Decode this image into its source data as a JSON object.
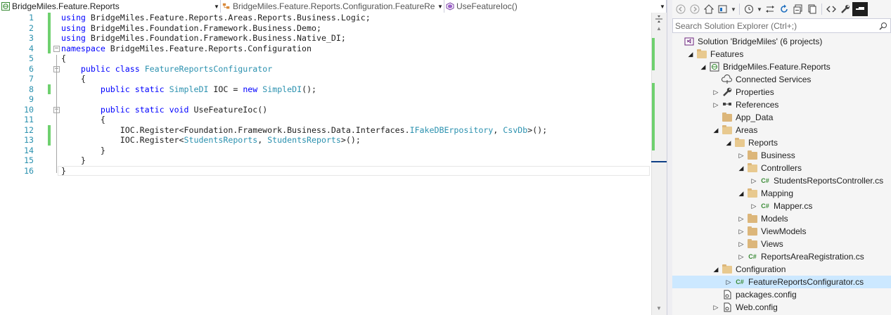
{
  "navbar": {
    "project": "BridgeMiles.Feature.Reports",
    "type": "BridgeMiles.Feature.Reports.Configuration.FeatureRe",
    "member": "UseFeatureIoc()"
  },
  "editor": {
    "lines": [
      {
        "n": "1",
        "segs": [
          [
            "kw",
            "using"
          ],
          [
            "pl",
            " BridgeMiles.Feature.Reports.Areas.Reports.Business.Logic;"
          ]
        ]
      },
      {
        "n": "2",
        "segs": [
          [
            "kw",
            "using"
          ],
          [
            "pl",
            " BridgeMiles.Foundation.Framework.Business.Demo;"
          ]
        ]
      },
      {
        "n": "3",
        "segs": [
          [
            "kw",
            "using"
          ],
          [
            "pl",
            " BridgeMiles.Foundation.Framework.Business.Native_DI;"
          ]
        ]
      },
      {
        "n": "4",
        "segs": [
          [
            "kw",
            "namespace"
          ],
          [
            "pl",
            " BridgeMiles.Feature.Reports.Configuration"
          ]
        ]
      },
      {
        "n": "5",
        "segs": [
          [
            "pl",
            "{"
          ]
        ]
      },
      {
        "n": "6",
        "segs": [
          [
            "pl",
            "    "
          ],
          [
            "kw",
            "public"
          ],
          [
            "pl",
            " "
          ],
          [
            "kw",
            "class"
          ],
          [
            "pl",
            " "
          ],
          [
            "ty",
            "FeatureReportsConfigurator"
          ]
        ]
      },
      {
        "n": "7",
        "segs": [
          [
            "pl",
            "    {"
          ]
        ]
      },
      {
        "n": "8",
        "segs": [
          [
            "pl",
            "        "
          ],
          [
            "kw",
            "public"
          ],
          [
            "pl",
            " "
          ],
          [
            "kw",
            "static"
          ],
          [
            "pl",
            " "
          ],
          [
            "ty",
            "SimpleDI"
          ],
          [
            "pl",
            " IOC = "
          ],
          [
            "kw",
            "new"
          ],
          [
            "pl",
            " "
          ],
          [
            "ty",
            "SimpleDI"
          ],
          [
            "pl",
            "();"
          ]
        ]
      },
      {
        "n": "9",
        "segs": [
          [
            "pl",
            ""
          ]
        ]
      },
      {
        "n": "10",
        "segs": [
          [
            "pl",
            "        "
          ],
          [
            "kw",
            "public"
          ],
          [
            "pl",
            " "
          ],
          [
            "kw",
            "static"
          ],
          [
            "pl",
            " "
          ],
          [
            "kw",
            "void"
          ],
          [
            "pl",
            " UseFeatureIoc()"
          ]
        ]
      },
      {
        "n": "11",
        "segs": [
          [
            "pl",
            "        {"
          ]
        ]
      },
      {
        "n": "12",
        "segs": [
          [
            "pl",
            "            IOC.Register<Foundation.Framework.Business.Data.Interfaces."
          ],
          [
            "ty",
            "IFakeDBErpository"
          ],
          [
            "pl",
            ", "
          ],
          [
            "ty",
            "CsvDb"
          ],
          [
            "pl",
            ">();"
          ]
        ]
      },
      {
        "n": "13",
        "segs": [
          [
            "pl",
            "            IOC.Register<"
          ],
          [
            "ty",
            "StudentsReports"
          ],
          [
            "pl",
            ", "
          ],
          [
            "ty",
            "StudentsReports"
          ],
          [
            "pl",
            ">();"
          ]
        ]
      },
      {
        "n": "14",
        "segs": [
          [
            "pl",
            "        }"
          ]
        ]
      },
      {
        "n": "15",
        "segs": [
          [
            "pl",
            "    }"
          ]
        ]
      },
      {
        "n": "16",
        "segs": [
          [
            "pl",
            "}"
          ]
        ]
      }
    ]
  },
  "solution_explorer": {
    "search_placeholder": "Search Solution Explorer (Ctrl+;)",
    "tree": [
      {
        "label": "Solution 'BridgeMiles' (6 projects)",
        "level": 0,
        "icon": "solution-icon",
        "exp": ""
      },
      {
        "label": "Features",
        "level": 1,
        "icon": "folder-open-icon",
        "exp": "open"
      },
      {
        "label": "BridgeMiles.Feature.Reports",
        "level": 2,
        "icon": "web-project-icon",
        "exp": "open"
      },
      {
        "label": "Connected Services",
        "level": 3,
        "icon": "connected-services-icon",
        "exp": ""
      },
      {
        "label": "Properties",
        "level": 3,
        "icon": "wrench-icon",
        "exp": "closed"
      },
      {
        "label": "References",
        "level": 3,
        "icon": "references-icon",
        "exp": "closed"
      },
      {
        "label": "App_Data",
        "level": 3,
        "icon": "folder-icon",
        "exp": ""
      },
      {
        "label": "Areas",
        "level": 3,
        "icon": "folder-open-icon",
        "exp": "open"
      },
      {
        "label": "Reports",
        "level": 4,
        "icon": "folder-open-icon",
        "exp": "open"
      },
      {
        "label": "Business",
        "level": 5,
        "icon": "folder-icon",
        "exp": "closed"
      },
      {
        "label": "Controllers",
        "level": 5,
        "icon": "folder-open-icon",
        "exp": "open"
      },
      {
        "label": "StudentsReportsController.cs",
        "level": 6,
        "icon": "csharp-file-icon",
        "exp": "closed"
      },
      {
        "label": "Mapping",
        "level": 5,
        "icon": "folder-open-icon",
        "exp": "open"
      },
      {
        "label": "Mapper.cs",
        "level": 6,
        "icon": "csharp-file-icon",
        "exp": "closed"
      },
      {
        "label": "Models",
        "level": 5,
        "icon": "folder-icon",
        "exp": "closed"
      },
      {
        "label": "ViewModels",
        "level": 5,
        "icon": "folder-icon",
        "exp": "closed"
      },
      {
        "label": "Views",
        "level": 5,
        "icon": "folder-icon",
        "exp": "closed"
      },
      {
        "label": "ReportsAreaRegistration.cs",
        "level": 5,
        "icon": "csharp-file-icon",
        "exp": "closed"
      },
      {
        "label": "Configuration",
        "level": 3,
        "icon": "folder-open-icon",
        "exp": "open"
      },
      {
        "label": "FeatureReportsConfigurator.cs",
        "level": 4,
        "icon": "csharp-file-icon",
        "exp": "closed",
        "selected": true
      },
      {
        "label": "packages.config",
        "level": 3,
        "icon": "config-file-icon",
        "exp": ""
      },
      {
        "label": "Web.config",
        "level": 3,
        "icon": "web-config-icon",
        "exp": "closed"
      }
    ]
  },
  "colors": {
    "keyword": "#0000ff",
    "type": "#2b91af",
    "line_number": "#2b91af",
    "changed_saved": "#6fd06f",
    "selection": "#cce8ff"
  }
}
